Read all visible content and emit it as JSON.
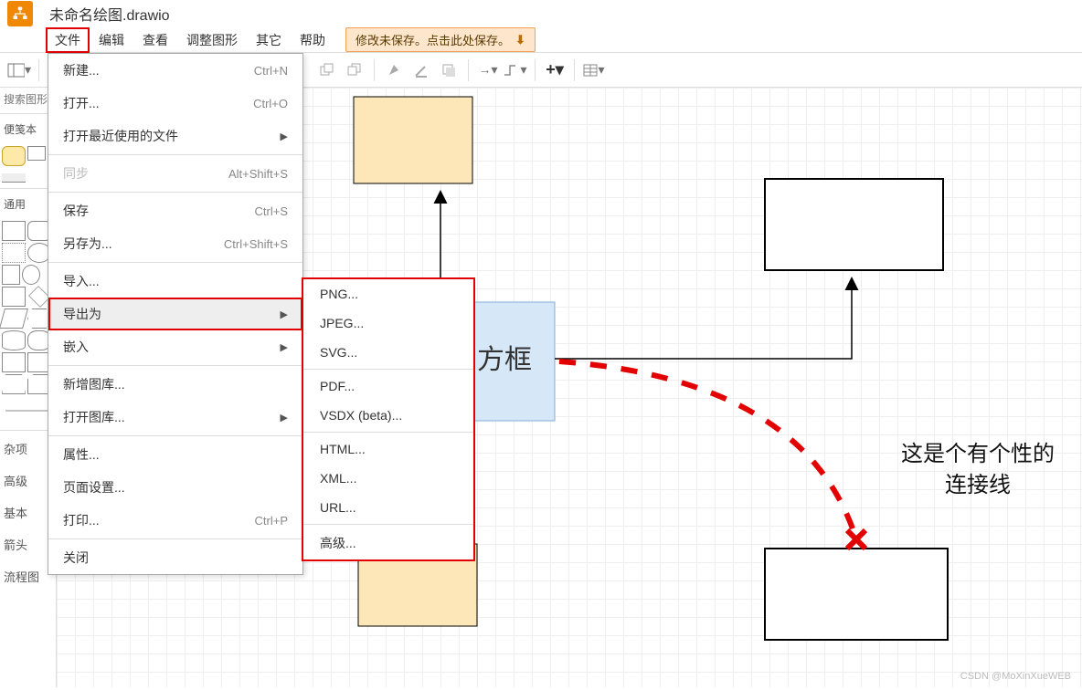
{
  "title": "未命名绘图.drawio",
  "menubar": [
    "文件",
    "编辑",
    "查看",
    "调整图形",
    "其它",
    "帮助"
  ],
  "save_notice": "修改未保存。点击此处保存。",
  "search_placeholder": "搜索图形",
  "sidebar": {
    "scratchpad": "便笺本",
    "general": "通用",
    "categories": [
      "杂项",
      "高级",
      "基本",
      "箭头",
      "流程图"
    ]
  },
  "file_menu": {
    "new": {
      "label": "新建...",
      "shortcut": "Ctrl+N"
    },
    "open": {
      "label": "打开...",
      "shortcut": "Ctrl+O"
    },
    "open_recent": {
      "label": "打开最近使用的文件"
    },
    "sync": {
      "label": "同步",
      "shortcut": "Alt+Shift+S"
    },
    "save": {
      "label": "保存",
      "shortcut": "Ctrl+S"
    },
    "save_as": {
      "label": "另存为...",
      "shortcut": "Ctrl+Shift+S"
    },
    "import": {
      "label": "导入..."
    },
    "export_as": {
      "label": "导出为"
    },
    "embed": {
      "label": "嵌入"
    },
    "new_lib": {
      "label": "新增图库..."
    },
    "open_lib": {
      "label": "打开图库..."
    },
    "props": {
      "label": "属性..."
    },
    "page_setup": {
      "label": "页面设置..."
    },
    "print": {
      "label": "打印...",
      "shortcut": "Ctrl+P"
    },
    "close": {
      "label": "关闭"
    }
  },
  "export_menu": [
    "PNG...",
    "JPEG...",
    "SVG...",
    "PDF...",
    "VSDX (beta)...",
    "HTML...",
    "XML...",
    "URL...",
    "高级..."
  ],
  "canvas": {
    "center_box": "方框",
    "annotation_line1": "这是个有个性的",
    "annotation_line2": "连接线"
  },
  "watermark": "CSDN @MoXinXueWEB"
}
